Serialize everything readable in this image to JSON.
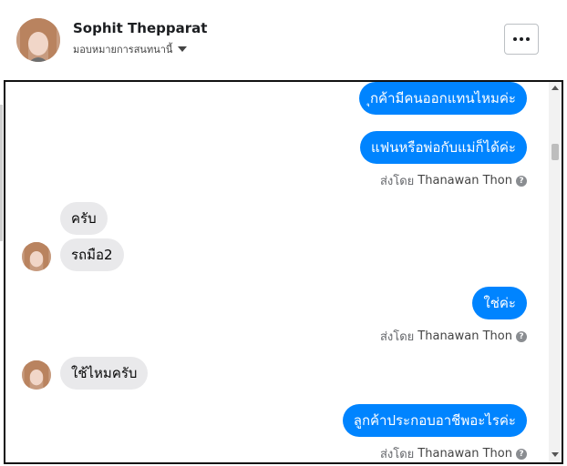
{
  "header": {
    "contact_name": "Sophit Thepparat",
    "assign_label": "มอบหมายการสนทนานี้"
  },
  "messages": {
    "out1": "ุกค้ามีคนออกแทนไหมค่ะ",
    "out2": "แฟนหรือพ่อกับแม่ก็ได้ค่ะ",
    "in1": "ครับ",
    "in2": "รถมือ2",
    "out3": "ใช่ค่ะ",
    "in3": "ใช้ไหมครับ",
    "out4": "ลูกค้าประกอบอาชีพอะไรค่ะ"
  },
  "sent_by": {
    "prefix": "ส่งโดย",
    "agent": "Thanawan Thon",
    "help": "?"
  },
  "colors": {
    "outgoing": "#0084ff",
    "incoming": "#e9e9eb"
  },
  "icons": {
    "more": "more-horizontal-icon",
    "caret": "caret-down-icon",
    "help": "question-circle-icon"
  }
}
